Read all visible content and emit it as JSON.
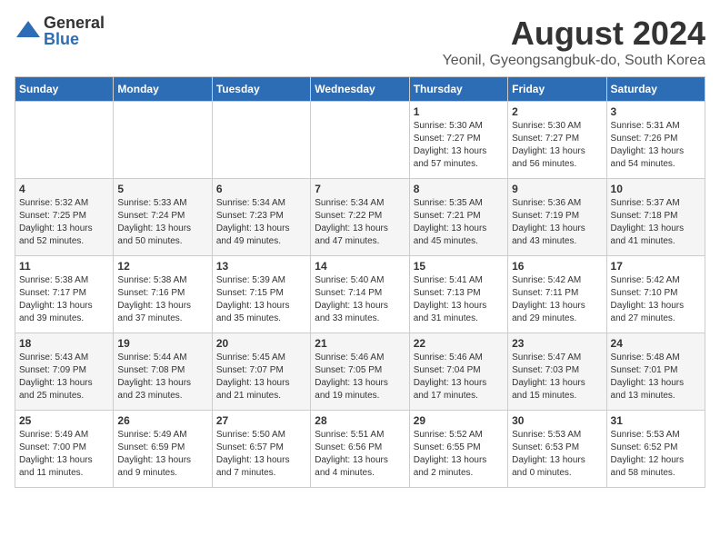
{
  "logo": {
    "general": "General",
    "blue": "Blue"
  },
  "title": "August 2024",
  "location": "Yeonil, Gyeongsangbuk-do, South Korea",
  "days_of_week": [
    "Sunday",
    "Monday",
    "Tuesday",
    "Wednesday",
    "Thursday",
    "Friday",
    "Saturday"
  ],
  "weeks": [
    [
      {
        "day": "",
        "info": ""
      },
      {
        "day": "",
        "info": ""
      },
      {
        "day": "",
        "info": ""
      },
      {
        "day": "",
        "info": ""
      },
      {
        "day": "1",
        "info": "Sunrise: 5:30 AM\nSunset: 7:27 PM\nDaylight: 13 hours\nand 57 minutes."
      },
      {
        "day": "2",
        "info": "Sunrise: 5:30 AM\nSunset: 7:27 PM\nDaylight: 13 hours\nand 56 minutes."
      },
      {
        "day": "3",
        "info": "Sunrise: 5:31 AM\nSunset: 7:26 PM\nDaylight: 13 hours\nand 54 minutes."
      }
    ],
    [
      {
        "day": "4",
        "info": "Sunrise: 5:32 AM\nSunset: 7:25 PM\nDaylight: 13 hours\nand 52 minutes."
      },
      {
        "day": "5",
        "info": "Sunrise: 5:33 AM\nSunset: 7:24 PM\nDaylight: 13 hours\nand 50 minutes."
      },
      {
        "day": "6",
        "info": "Sunrise: 5:34 AM\nSunset: 7:23 PM\nDaylight: 13 hours\nand 49 minutes."
      },
      {
        "day": "7",
        "info": "Sunrise: 5:34 AM\nSunset: 7:22 PM\nDaylight: 13 hours\nand 47 minutes."
      },
      {
        "day": "8",
        "info": "Sunrise: 5:35 AM\nSunset: 7:21 PM\nDaylight: 13 hours\nand 45 minutes."
      },
      {
        "day": "9",
        "info": "Sunrise: 5:36 AM\nSunset: 7:19 PM\nDaylight: 13 hours\nand 43 minutes."
      },
      {
        "day": "10",
        "info": "Sunrise: 5:37 AM\nSunset: 7:18 PM\nDaylight: 13 hours\nand 41 minutes."
      }
    ],
    [
      {
        "day": "11",
        "info": "Sunrise: 5:38 AM\nSunset: 7:17 PM\nDaylight: 13 hours\nand 39 minutes."
      },
      {
        "day": "12",
        "info": "Sunrise: 5:38 AM\nSunset: 7:16 PM\nDaylight: 13 hours\nand 37 minutes."
      },
      {
        "day": "13",
        "info": "Sunrise: 5:39 AM\nSunset: 7:15 PM\nDaylight: 13 hours\nand 35 minutes."
      },
      {
        "day": "14",
        "info": "Sunrise: 5:40 AM\nSunset: 7:14 PM\nDaylight: 13 hours\nand 33 minutes."
      },
      {
        "day": "15",
        "info": "Sunrise: 5:41 AM\nSunset: 7:13 PM\nDaylight: 13 hours\nand 31 minutes."
      },
      {
        "day": "16",
        "info": "Sunrise: 5:42 AM\nSunset: 7:11 PM\nDaylight: 13 hours\nand 29 minutes."
      },
      {
        "day": "17",
        "info": "Sunrise: 5:42 AM\nSunset: 7:10 PM\nDaylight: 13 hours\nand 27 minutes."
      }
    ],
    [
      {
        "day": "18",
        "info": "Sunrise: 5:43 AM\nSunset: 7:09 PM\nDaylight: 13 hours\nand 25 minutes."
      },
      {
        "day": "19",
        "info": "Sunrise: 5:44 AM\nSunset: 7:08 PM\nDaylight: 13 hours\nand 23 minutes."
      },
      {
        "day": "20",
        "info": "Sunrise: 5:45 AM\nSunset: 7:07 PM\nDaylight: 13 hours\nand 21 minutes."
      },
      {
        "day": "21",
        "info": "Sunrise: 5:46 AM\nSunset: 7:05 PM\nDaylight: 13 hours\nand 19 minutes."
      },
      {
        "day": "22",
        "info": "Sunrise: 5:46 AM\nSunset: 7:04 PM\nDaylight: 13 hours\nand 17 minutes."
      },
      {
        "day": "23",
        "info": "Sunrise: 5:47 AM\nSunset: 7:03 PM\nDaylight: 13 hours\nand 15 minutes."
      },
      {
        "day": "24",
        "info": "Sunrise: 5:48 AM\nSunset: 7:01 PM\nDaylight: 13 hours\nand 13 minutes."
      }
    ],
    [
      {
        "day": "25",
        "info": "Sunrise: 5:49 AM\nSunset: 7:00 PM\nDaylight: 13 hours\nand 11 minutes."
      },
      {
        "day": "26",
        "info": "Sunrise: 5:49 AM\nSunset: 6:59 PM\nDaylight: 13 hours\nand 9 minutes."
      },
      {
        "day": "27",
        "info": "Sunrise: 5:50 AM\nSunset: 6:57 PM\nDaylight: 13 hours\nand 7 minutes."
      },
      {
        "day": "28",
        "info": "Sunrise: 5:51 AM\nSunset: 6:56 PM\nDaylight: 13 hours\nand 4 minutes."
      },
      {
        "day": "29",
        "info": "Sunrise: 5:52 AM\nSunset: 6:55 PM\nDaylight: 13 hours\nand 2 minutes."
      },
      {
        "day": "30",
        "info": "Sunrise: 5:53 AM\nSunset: 6:53 PM\nDaylight: 13 hours\nand 0 minutes."
      },
      {
        "day": "31",
        "info": "Sunrise: 5:53 AM\nSunset: 6:52 PM\nDaylight: 12 hours\nand 58 minutes."
      }
    ]
  ]
}
